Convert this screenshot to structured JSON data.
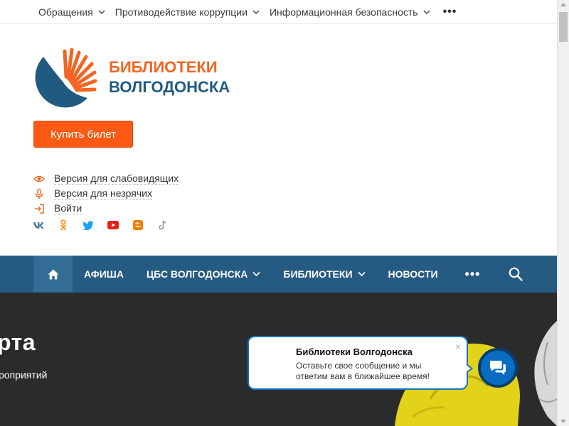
{
  "topbar": {
    "items": [
      {
        "label": "Обращения"
      },
      {
        "label": "Противодействие коррупции"
      },
      {
        "label": "Информационная безопасность"
      }
    ],
    "more": "•••"
  },
  "logo": {
    "line1": "БИБЛИОТЕКИ",
    "line2": "ВОЛГОДОНСКА",
    "orange": "#f26522",
    "blue": "#215a80"
  },
  "buy_button": {
    "label": "Купить билет",
    "color": "#fa5a14"
  },
  "accessibility": [
    {
      "label": "Версия для слабовидящих",
      "icon": "eye-icon"
    },
    {
      "label": "Версия для незрячих",
      "icon": "microphone-icon"
    },
    {
      "label": "Войти",
      "icon": "login-icon"
    }
  ],
  "socials": [
    "vk-icon",
    "odnoklassniki-icon",
    "twitter-icon",
    "youtube-icon",
    "blogger-icon",
    "tiktok-icon"
  ],
  "mainnav": {
    "color": "#255a82",
    "items": [
      {
        "label": "АФИША"
      },
      {
        "label": "ЦБС ВОЛГОДОНСКА"
      },
      {
        "label": "БИБЛИОТЕКИ"
      },
      {
        "label": "НОВОСТИ"
      }
    ],
    "more": "•••"
  },
  "hero": {
    "big_text": "рта",
    "small_text": "роприятий"
  },
  "chat": {
    "title": "Библиотеки Волгодонска",
    "message": "Оставьте свое сообщение и мы ответим вам в ближайшее время!",
    "close": "×"
  }
}
